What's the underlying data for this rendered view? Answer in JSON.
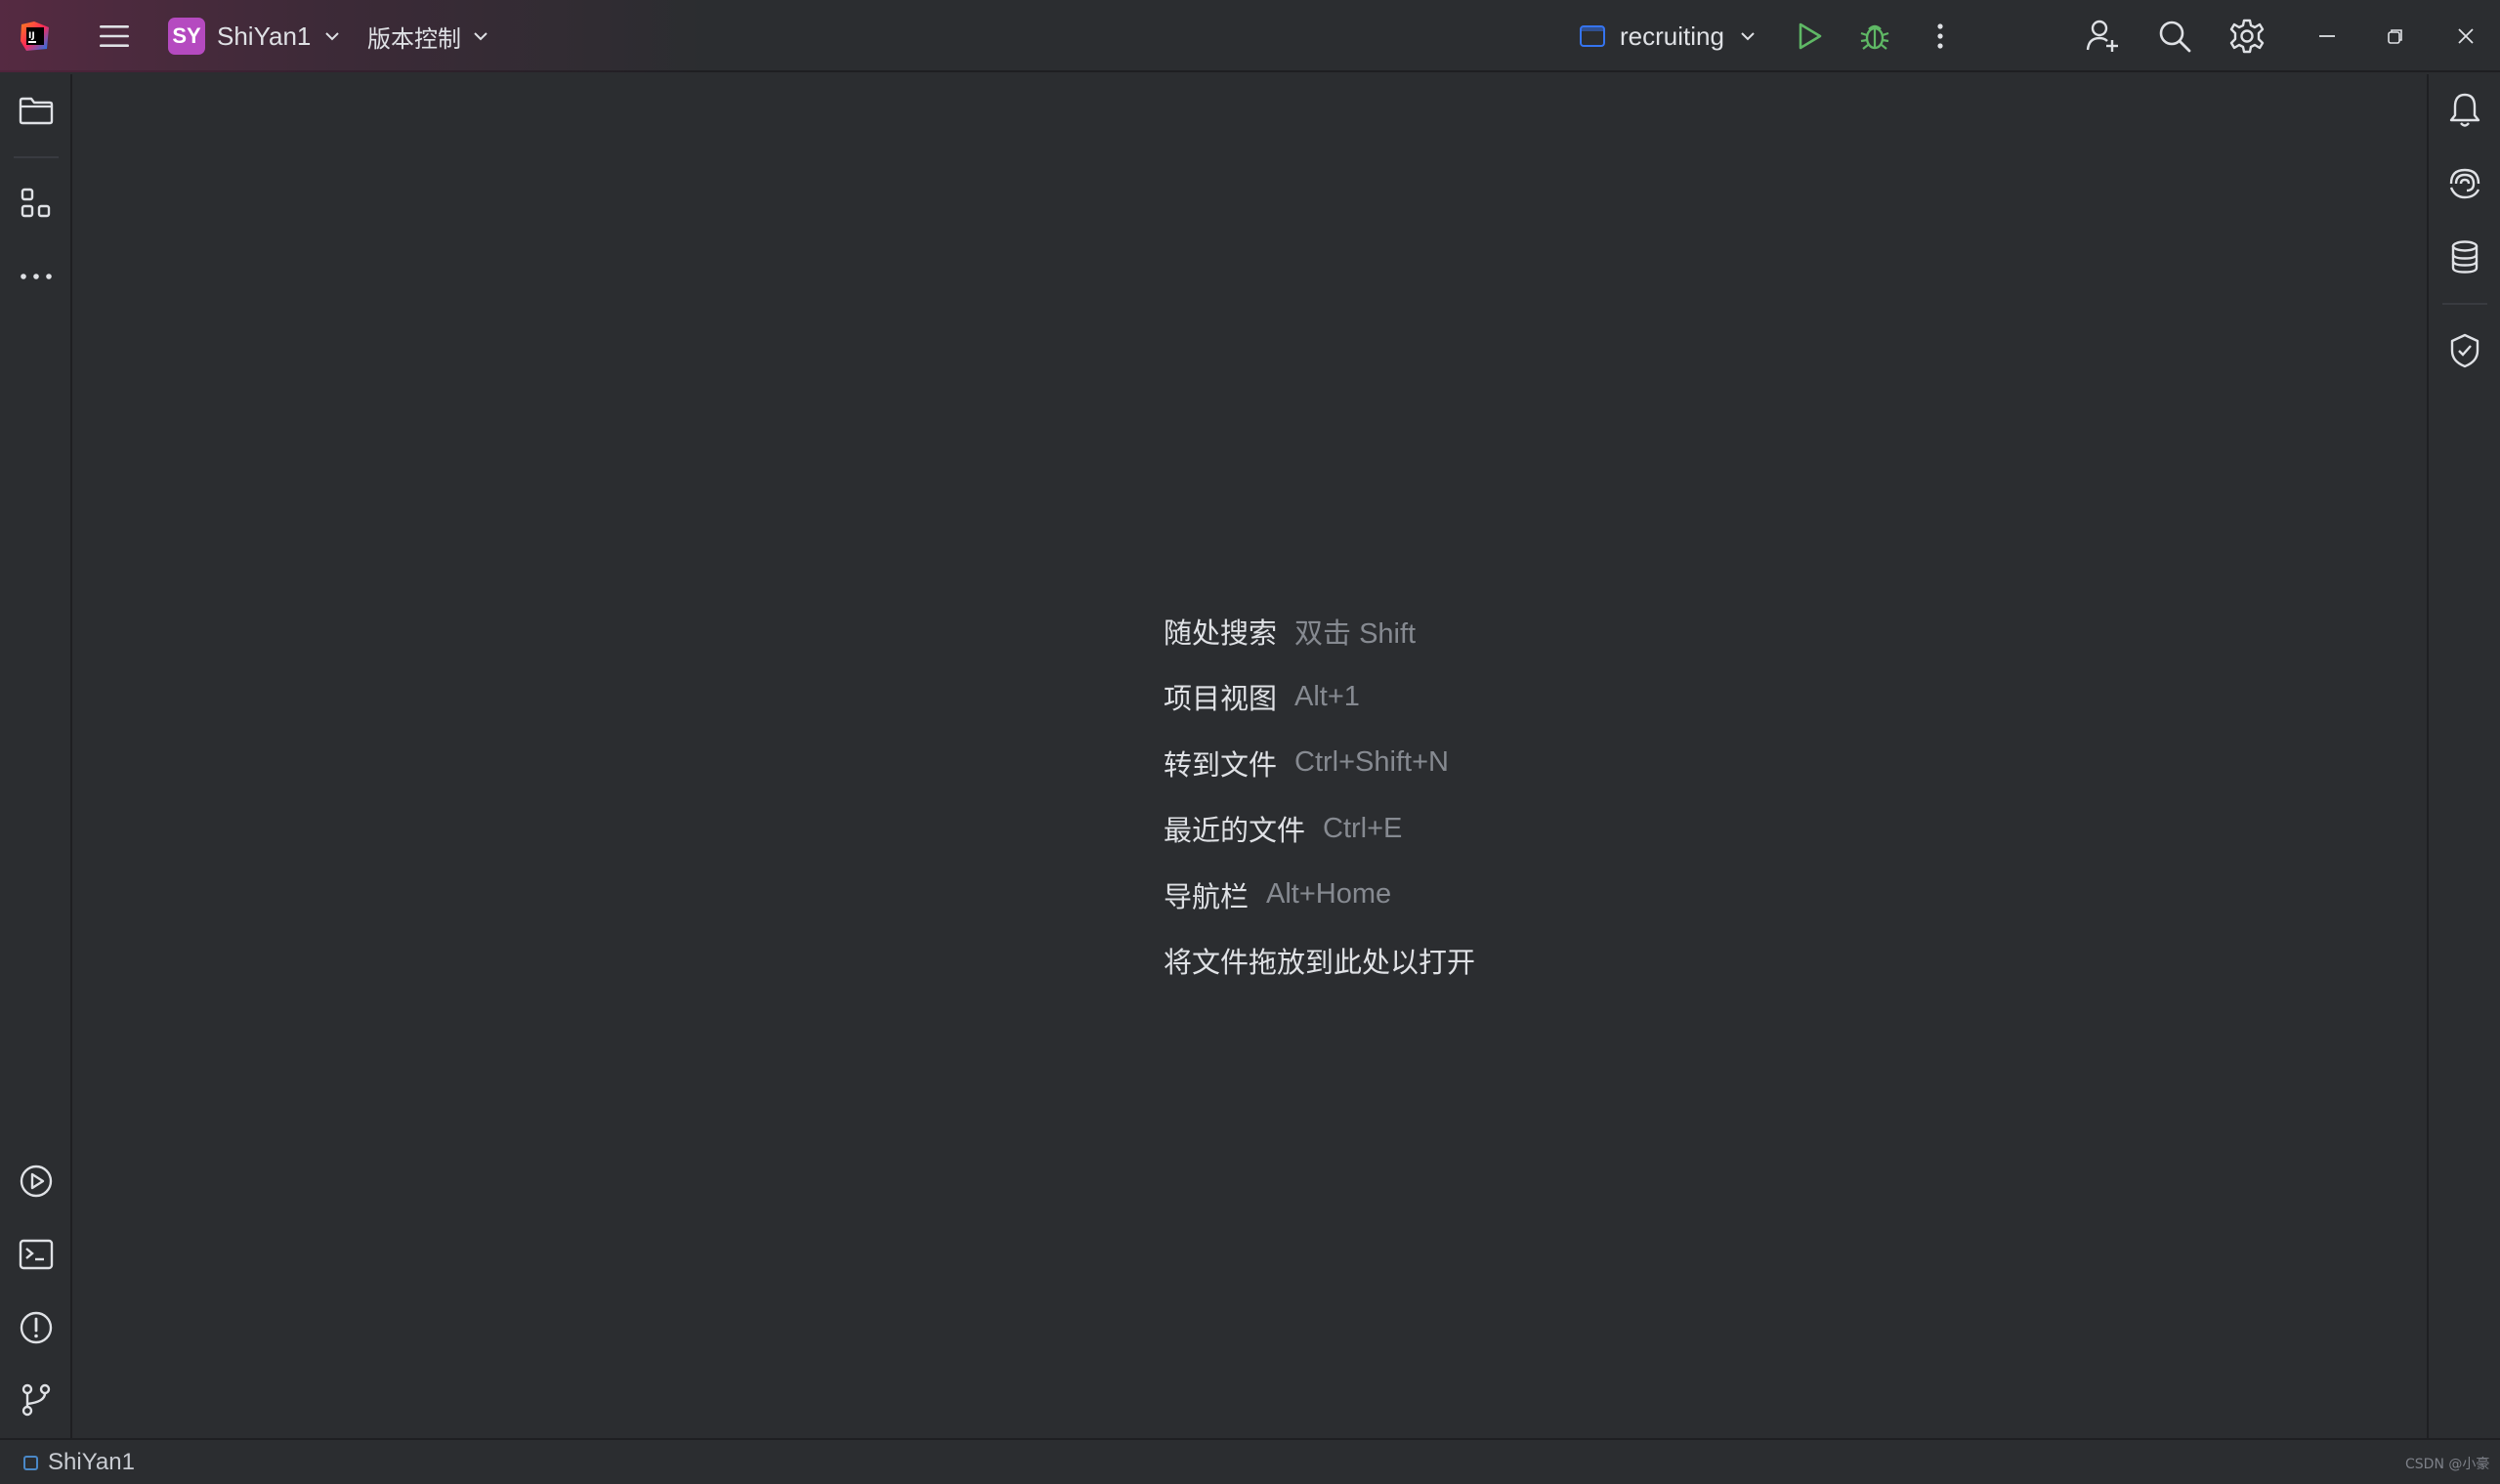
{
  "titlebar": {
    "app_icon": "intellij-logo-icon",
    "menu_icon": "hamburger-menu-icon",
    "project": {
      "avatar_initials": "SY",
      "name": "ShiYan1",
      "avatar_color": "#b54ac0"
    },
    "vcs_label": "版本控制",
    "run_configuration": {
      "name": "recruiting"
    },
    "buttons": {
      "run": "run-icon",
      "debug": "debug-icon",
      "more": "more-vertical-icon",
      "code_with_me": "add-user-icon",
      "search": "search-icon",
      "settings": "gear-icon",
      "minimize": "minimize-icon",
      "restore": "restore-icon",
      "close": "close-icon"
    }
  },
  "left_toolbar": {
    "top": [
      "folder-icon",
      "structure-icon",
      "more-horizontal-icon"
    ],
    "bottom": [
      "run-tool-icon",
      "terminal-icon",
      "problems-icon",
      "git-branch-icon"
    ]
  },
  "right_toolbar": [
    "bell-icon",
    "ai-assistant-icon",
    "database-icon",
    "shield-check-icon"
  ],
  "editor_hints": [
    {
      "action": "随处搜索",
      "shortcut": "双击 Shift"
    },
    {
      "action": "项目视图",
      "shortcut": "Alt+1"
    },
    {
      "action": "转到文件",
      "shortcut": "Ctrl+Shift+N"
    },
    {
      "action": "最近的文件",
      "shortcut": "Ctrl+E"
    },
    {
      "action": "导航栏",
      "shortcut": "Alt+Home"
    },
    {
      "action": "将文件拖放到此处以打开",
      "shortcut": ""
    }
  ],
  "statusbar": {
    "project_name": "ShiYan1",
    "watermark": "CSDN @小豪"
  },
  "colors": {
    "background": "#2b2d30",
    "run_green": "#5fb865",
    "text": "#dfe1e5",
    "muted_text": "#868a91",
    "accent_blue": "#4a88c7"
  }
}
